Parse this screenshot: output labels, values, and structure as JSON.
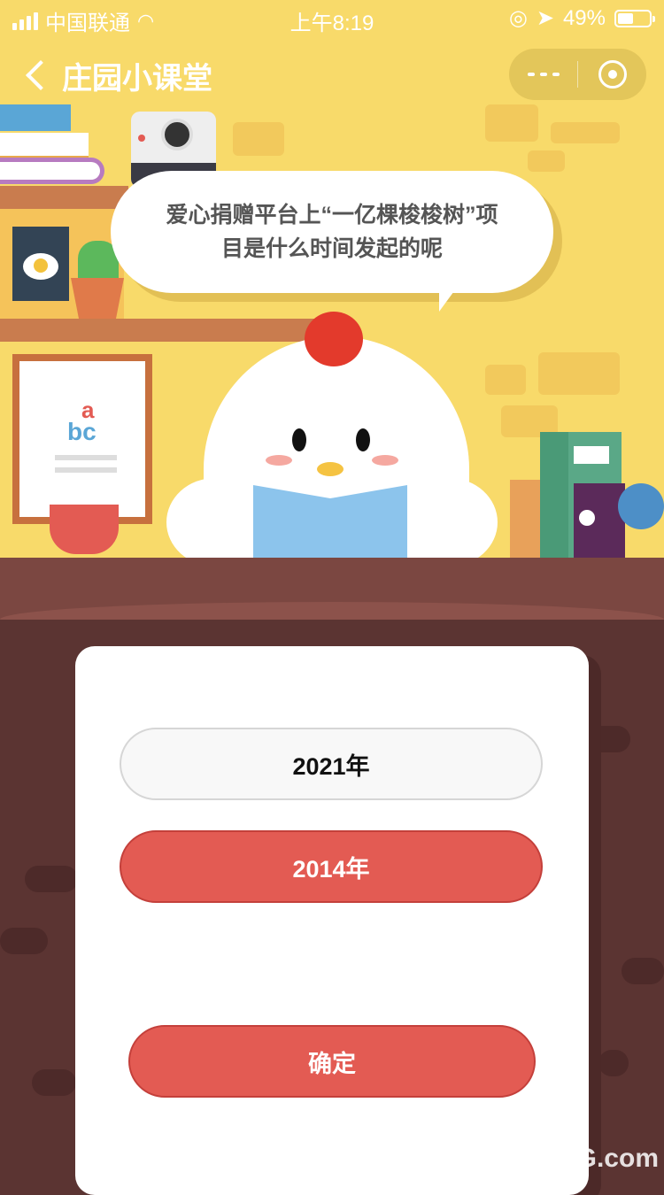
{
  "status_bar": {
    "carrier": "中国联通",
    "time": "上午8:19",
    "battery": "49%",
    "battery_level": 0.49
  },
  "nav": {
    "title": "庄园小课堂"
  },
  "question": {
    "line1": "爱心捐赠平台上“一亿棵梭梭树”项",
    "line2": "目是什么时间发起的呢"
  },
  "decor": {
    "abc_top": "a",
    "abc_bottom": "bc"
  },
  "options": [
    {
      "label": "2021年",
      "selected": false
    },
    {
      "label": "2014年",
      "selected": true
    }
  ],
  "confirm_label": "确定",
  "watermark": "UG.com",
  "colors": {
    "sky": "#f8da6a",
    "accent_red": "#e35b53",
    "floor": "#5b3432"
  }
}
